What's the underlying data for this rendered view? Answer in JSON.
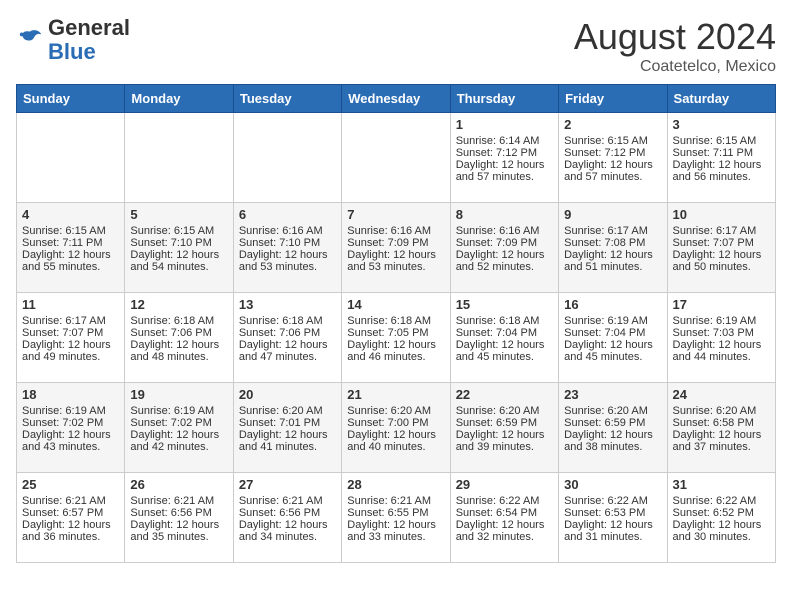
{
  "header": {
    "logo_general": "General",
    "logo_blue": "Blue",
    "month_year": "August 2024",
    "location": "Coatetelco, Mexico"
  },
  "weekdays": [
    "Sunday",
    "Monday",
    "Tuesday",
    "Wednesday",
    "Thursday",
    "Friday",
    "Saturday"
  ],
  "weeks": [
    [
      {
        "day": "",
        "content": ""
      },
      {
        "day": "",
        "content": ""
      },
      {
        "day": "",
        "content": ""
      },
      {
        "day": "",
        "content": ""
      },
      {
        "day": "1",
        "content": "Sunrise: 6:14 AM\nSunset: 7:12 PM\nDaylight: 12 hours\nand 57 minutes."
      },
      {
        "day": "2",
        "content": "Sunrise: 6:15 AM\nSunset: 7:12 PM\nDaylight: 12 hours\nand 57 minutes."
      },
      {
        "day": "3",
        "content": "Sunrise: 6:15 AM\nSunset: 7:11 PM\nDaylight: 12 hours\nand 56 minutes."
      }
    ],
    [
      {
        "day": "4",
        "content": "Sunrise: 6:15 AM\nSunset: 7:11 PM\nDaylight: 12 hours\nand 55 minutes."
      },
      {
        "day": "5",
        "content": "Sunrise: 6:15 AM\nSunset: 7:10 PM\nDaylight: 12 hours\nand 54 minutes."
      },
      {
        "day": "6",
        "content": "Sunrise: 6:16 AM\nSunset: 7:10 PM\nDaylight: 12 hours\nand 53 minutes."
      },
      {
        "day": "7",
        "content": "Sunrise: 6:16 AM\nSunset: 7:09 PM\nDaylight: 12 hours\nand 53 minutes."
      },
      {
        "day": "8",
        "content": "Sunrise: 6:16 AM\nSunset: 7:09 PM\nDaylight: 12 hours\nand 52 minutes."
      },
      {
        "day": "9",
        "content": "Sunrise: 6:17 AM\nSunset: 7:08 PM\nDaylight: 12 hours\nand 51 minutes."
      },
      {
        "day": "10",
        "content": "Sunrise: 6:17 AM\nSunset: 7:07 PM\nDaylight: 12 hours\nand 50 minutes."
      }
    ],
    [
      {
        "day": "11",
        "content": "Sunrise: 6:17 AM\nSunset: 7:07 PM\nDaylight: 12 hours\nand 49 minutes."
      },
      {
        "day": "12",
        "content": "Sunrise: 6:18 AM\nSunset: 7:06 PM\nDaylight: 12 hours\nand 48 minutes."
      },
      {
        "day": "13",
        "content": "Sunrise: 6:18 AM\nSunset: 7:06 PM\nDaylight: 12 hours\nand 47 minutes."
      },
      {
        "day": "14",
        "content": "Sunrise: 6:18 AM\nSunset: 7:05 PM\nDaylight: 12 hours\nand 46 minutes."
      },
      {
        "day": "15",
        "content": "Sunrise: 6:18 AM\nSunset: 7:04 PM\nDaylight: 12 hours\nand 45 minutes."
      },
      {
        "day": "16",
        "content": "Sunrise: 6:19 AM\nSunset: 7:04 PM\nDaylight: 12 hours\nand 45 minutes."
      },
      {
        "day": "17",
        "content": "Sunrise: 6:19 AM\nSunset: 7:03 PM\nDaylight: 12 hours\nand 44 minutes."
      }
    ],
    [
      {
        "day": "18",
        "content": "Sunrise: 6:19 AM\nSunset: 7:02 PM\nDaylight: 12 hours\nand 43 minutes."
      },
      {
        "day": "19",
        "content": "Sunrise: 6:19 AM\nSunset: 7:02 PM\nDaylight: 12 hours\nand 42 minutes."
      },
      {
        "day": "20",
        "content": "Sunrise: 6:20 AM\nSunset: 7:01 PM\nDaylight: 12 hours\nand 41 minutes."
      },
      {
        "day": "21",
        "content": "Sunrise: 6:20 AM\nSunset: 7:00 PM\nDaylight: 12 hours\nand 40 minutes."
      },
      {
        "day": "22",
        "content": "Sunrise: 6:20 AM\nSunset: 6:59 PM\nDaylight: 12 hours\nand 39 minutes."
      },
      {
        "day": "23",
        "content": "Sunrise: 6:20 AM\nSunset: 6:59 PM\nDaylight: 12 hours\nand 38 minutes."
      },
      {
        "day": "24",
        "content": "Sunrise: 6:20 AM\nSunset: 6:58 PM\nDaylight: 12 hours\nand 37 minutes."
      }
    ],
    [
      {
        "day": "25",
        "content": "Sunrise: 6:21 AM\nSunset: 6:57 PM\nDaylight: 12 hours\nand 36 minutes."
      },
      {
        "day": "26",
        "content": "Sunrise: 6:21 AM\nSunset: 6:56 PM\nDaylight: 12 hours\nand 35 minutes."
      },
      {
        "day": "27",
        "content": "Sunrise: 6:21 AM\nSunset: 6:56 PM\nDaylight: 12 hours\nand 34 minutes."
      },
      {
        "day": "28",
        "content": "Sunrise: 6:21 AM\nSunset: 6:55 PM\nDaylight: 12 hours\nand 33 minutes."
      },
      {
        "day": "29",
        "content": "Sunrise: 6:22 AM\nSunset: 6:54 PM\nDaylight: 12 hours\nand 32 minutes."
      },
      {
        "day": "30",
        "content": "Sunrise: 6:22 AM\nSunset: 6:53 PM\nDaylight: 12 hours\nand 31 minutes."
      },
      {
        "day": "31",
        "content": "Sunrise: 6:22 AM\nSunset: 6:52 PM\nDaylight: 12 hours\nand 30 minutes."
      }
    ]
  ]
}
